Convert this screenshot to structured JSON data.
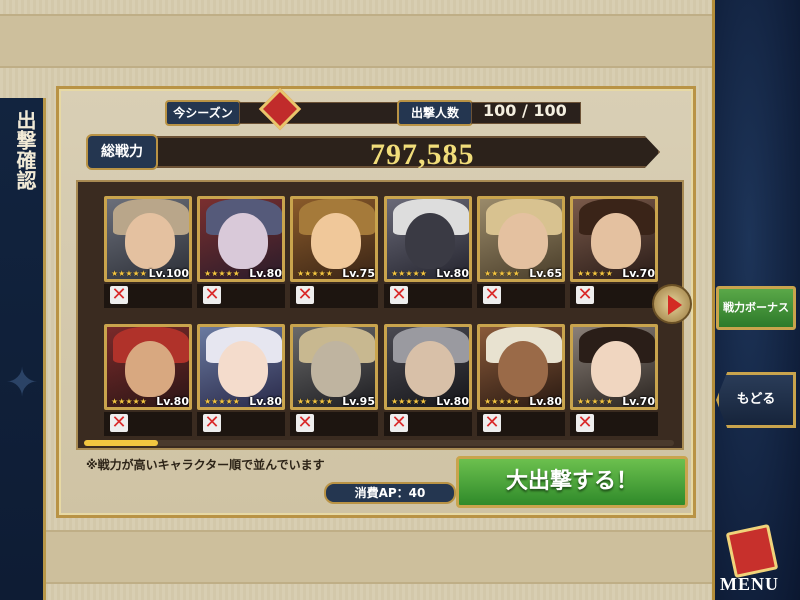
{
  "side": {
    "title": "出撃確認"
  },
  "season": {
    "label": "今シーズン"
  },
  "sortie_count": {
    "label": "出撃人数",
    "value": "100 / 100"
  },
  "power": {
    "label": "総戦力",
    "value": "797,585"
  },
  "cards": [
    {
      "level": "Lv.100",
      "stars": "★★★★★"
    },
    {
      "level": "Lv.80",
      "stars": "★★★★★"
    },
    {
      "level": "Lv.75",
      "stars": "★★★★★"
    },
    {
      "level": "Lv.80",
      "stars": "★★★★★"
    },
    {
      "level": "Lv.65",
      "stars": "★★★★★"
    },
    {
      "level": "Lv.70",
      "stars": "★★★★★"
    },
    {
      "level": "Lv.80",
      "stars": "★★★★★"
    },
    {
      "level": "Lv.80",
      "stars": "★★★★★"
    },
    {
      "level": "Lv.95",
      "stars": "★★★★★"
    },
    {
      "level": "Lv.80",
      "stars": "★★★★★"
    },
    {
      "level": "Lv.80",
      "stars": "★★★★★"
    },
    {
      "level": "Lv.70",
      "stars": "★★★★★"
    }
  ],
  "note": "※戦力が高いキャラクター順で並んでいます",
  "ap": {
    "label": "消費AP：40"
  },
  "buttons": {
    "sortie": "大出撃する！",
    "power_bonus": "戦力ボーナス",
    "back": "もどる",
    "menu": "MENU"
  },
  "colors": {
    "accent_gold": "#b99345",
    "navy": "#243650",
    "green": "#2f8a2a",
    "red_x": "#d92a2a"
  },
  "scroll": {
    "position": 0.0
  }
}
